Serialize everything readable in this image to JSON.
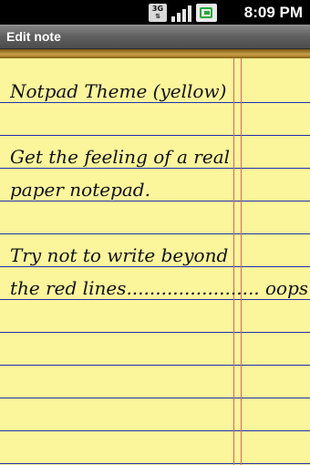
{
  "status_bar": {
    "network_type": "3G",
    "time": "8:09 PM",
    "icons": [
      "3g-data-icon",
      "signal-strength-icon",
      "battery-icon"
    ]
  },
  "header": {
    "title": "Edit note"
  },
  "note": {
    "lines": [
      "Notpad Theme (yellow)",
      "",
      "Get the feeling of a real",
      "paper notepad.",
      "",
      "Try not to write beyond",
      "the red lines....................... oops!"
    ]
  },
  "colors": {
    "paper": "#fbf59b",
    "ruled_line": "#1f2fb4",
    "margin_line": "#e55f5c",
    "header_bar": "#5f5f5f",
    "header_border": "#b88d2e"
  }
}
